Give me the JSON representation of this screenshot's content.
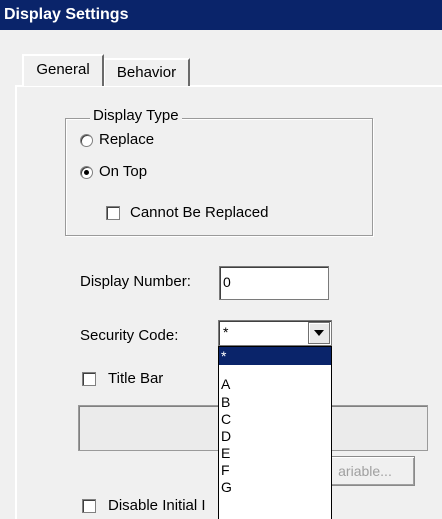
{
  "window": {
    "title": "Display Settings"
  },
  "tabs": [
    {
      "label": "General",
      "active": true
    },
    {
      "label": "Behavior",
      "active": false
    }
  ],
  "display_type": {
    "legend": "Display Type",
    "options": [
      {
        "label": "Replace",
        "checked": false
      },
      {
        "label": "On Top",
        "checked": true
      }
    ],
    "cannot_be_replaced": {
      "label": "Cannot Be Replaced",
      "checked": false
    }
  },
  "display_number": {
    "label": "Display Number:",
    "value": "0"
  },
  "security_code": {
    "label": "Security Code:",
    "value": "*",
    "options": [
      "*",
      "A",
      "B",
      "C",
      "D",
      "E",
      "F",
      "G"
    ],
    "selected_index": 0
  },
  "title_bar": {
    "label": "Title Bar",
    "checked": false
  },
  "variable_button": {
    "label": "ariable..."
  },
  "disable_initial": {
    "label": "Disable Initial I",
    "checked": false
  },
  "colors": {
    "title_bg": "#0a246a",
    "selection_bg": "#0a246a",
    "dialog_bg": "#f0f0f0"
  }
}
